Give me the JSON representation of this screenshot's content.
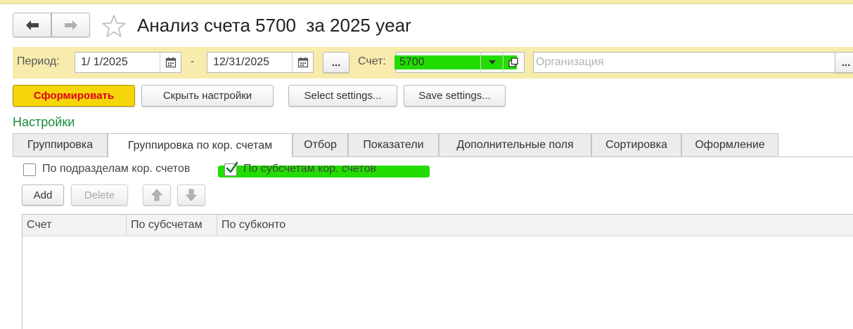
{
  "header": {
    "back_icon": "arrow-left-icon",
    "forward_icon": "arrow-right-icon",
    "favorite_icon": "star-icon",
    "title": "Анализ счета 5700  за 2025 year"
  },
  "filters": {
    "period_label": "Период:",
    "date_from": "1/ 1/2025",
    "dash": "-",
    "date_to": "12/31/2025",
    "period_choose_label": "...",
    "account_label": "Счет:",
    "account_value": "5700",
    "organization_placeholder": "Организация",
    "organization_choose_label": "..."
  },
  "toolbar": {
    "generate_label": "Сформировать",
    "hide_settings_label": "Скрыть настройки",
    "select_settings_label": "Select settings...",
    "save_settings_label": "Save settings..."
  },
  "settings": {
    "heading": "Настройки",
    "tabs": [
      {
        "label": "Группировка"
      },
      {
        "label": "Группировка по кор. счетам"
      },
      {
        "label": "Отбор"
      },
      {
        "label": "Показатели"
      },
      {
        "label": "Дополнительные поля"
      },
      {
        "label": "Сортировка"
      },
      {
        "label": "Оформление"
      }
    ],
    "active_tab": "Группировка по кор. счетам",
    "checkbox_subdivisions": {
      "label": "По подразделам кор. счетов",
      "checked": false
    },
    "checkbox_subaccounts": {
      "label": "По субсчетам кор. счетов",
      "checked": true
    },
    "add_label": "Add",
    "delete_label": "Delete",
    "move_up_icon": "arrow-up-icon",
    "move_down_icon": "arrow-down-icon",
    "table": {
      "columns": [
        "Счет",
        "По субсчетам",
        "По субконто"
      ],
      "rows": []
    }
  },
  "colors": {
    "panel_yellow": "#f8ecac",
    "generate_button": "#f5d60a",
    "generate_text": "#e0001a",
    "heading_green": "#1a8a3a",
    "highlight_green": "#22dd00"
  }
}
